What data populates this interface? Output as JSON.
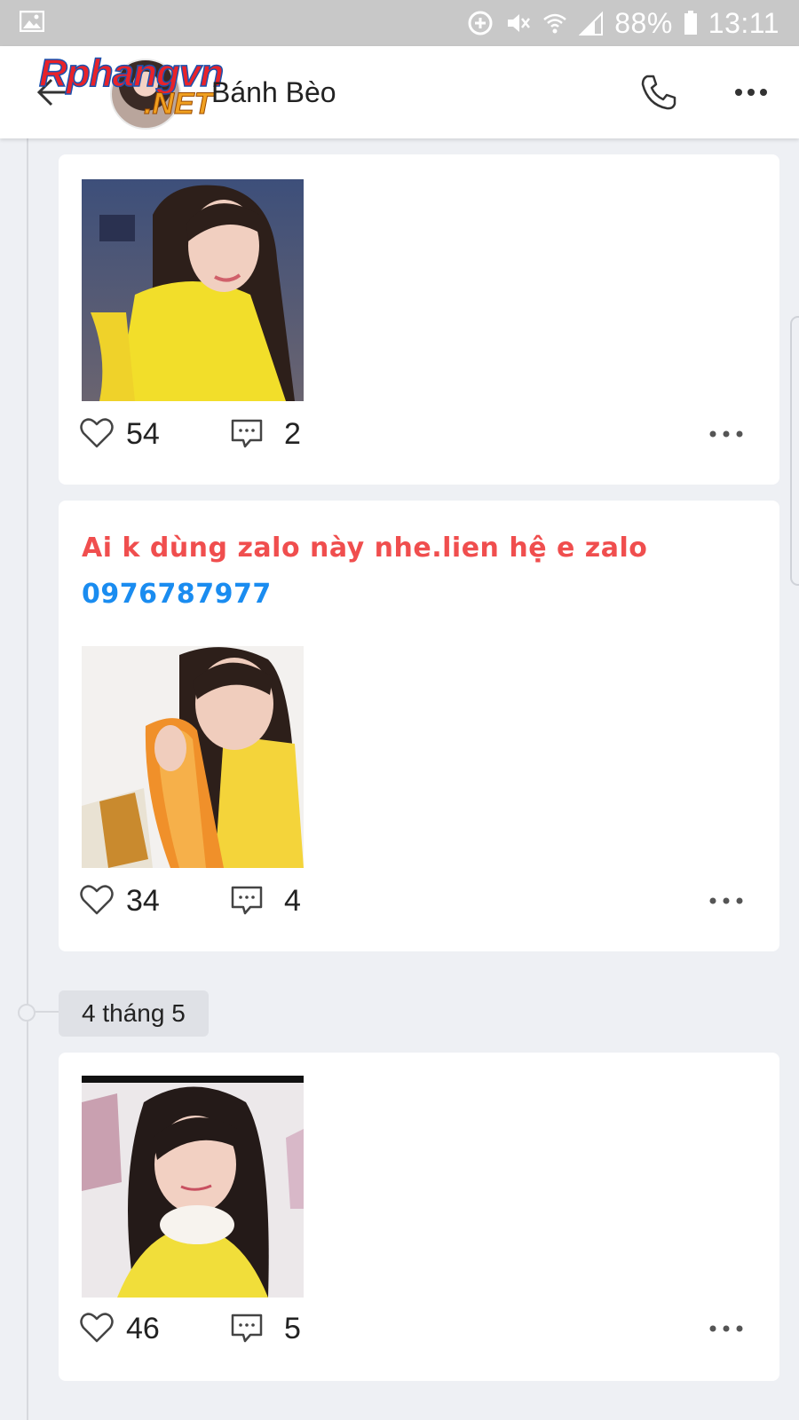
{
  "status_bar": {
    "battery": "88%",
    "time": "13:11",
    "icons": [
      "gallery-icon",
      "data-saver-icon",
      "mute-icon",
      "wifi-icon",
      "signal-icon",
      "battery-icon"
    ]
  },
  "header": {
    "title": "Bánh Bèo",
    "watermark_top": "Rphangvn",
    "watermark_bottom": ".NET",
    "icons": [
      "back-arrow-icon",
      "phone-icon",
      "more-icon"
    ]
  },
  "posts": [
    {
      "likes": "54",
      "comments": "2",
      "text_red": "",
      "text_blue": ""
    },
    {
      "likes": "34",
      "comments": "4",
      "text_red": "Ai k dùng zalo này nhe.lien hệ e zalo",
      "text_blue": "0976787977"
    },
    {
      "likes": "46",
      "comments": "5",
      "text_red": "",
      "text_blue": ""
    }
  ],
  "date_separator": "4 tháng 5",
  "colors": {
    "status_bar": "#c8c8c8",
    "background": "#eef0f4",
    "text_red": "#f04e4e",
    "text_blue": "#1a8cf0",
    "photo_yellow": "#f2de2a"
  }
}
